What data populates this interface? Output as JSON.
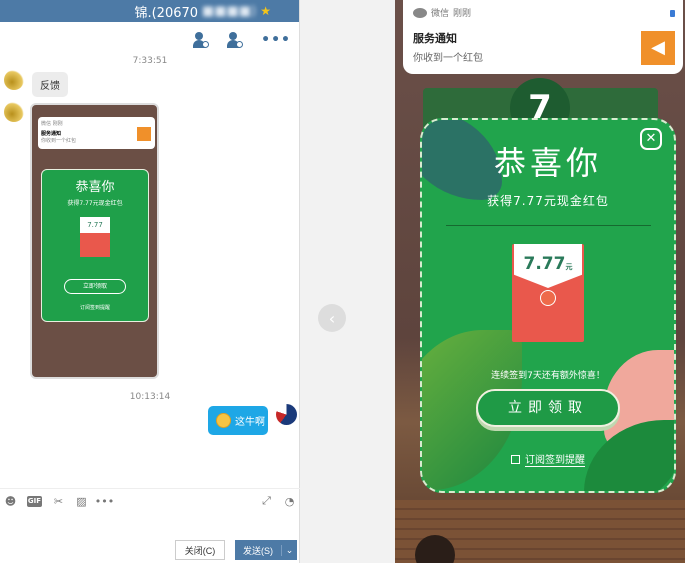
{
  "chat": {
    "title": "锦.(20670",
    "header_icons": [
      "add-contact-icon",
      "block-contact-icon",
      "more-icon"
    ],
    "more_label": "•••",
    "messages": [
      {
        "time": "7:33:51",
        "text": "反馈",
        "direction": "received"
      },
      {
        "type": "image",
        "direction": "received"
      },
      {
        "time": "10:13:14",
        "text": "这牛啊",
        "direction": "sent"
      }
    ],
    "thumbnail": {
      "notif_app": "微信 刚刚",
      "notif_title": "服务通知",
      "notif_body": "你收到一个红包",
      "card_title": "恭喜你",
      "card_sub": "获得7.77元现金红包",
      "amount": "7.77",
      "claim": "立即领取",
      "subscribe": "订阅签到提醒"
    },
    "toolbar": {
      "gif": "GIF",
      "more": "•••"
    },
    "close_button": "关闭(C)",
    "send_button": "发送(S)",
    "send_dropdown": "⌄"
  },
  "viewer": {
    "prev_arrow": "‹"
  },
  "screenshot": {
    "notification": {
      "app": "微信",
      "time": "刚刚",
      "title": "服务通知",
      "body": "你收到一个红包"
    },
    "bg_badge": "7",
    "card": {
      "close": "✕",
      "title": "恭喜你",
      "subtitle": "获得7.77元现金红包",
      "amount": "7.77",
      "unit": "元",
      "note": "连续签到7天还有额外惊喜！",
      "claim_button": "立即领取",
      "subscribe_label": "订阅签到提醒"
    },
    "colors": {
      "card_green": "#21a44c",
      "envelope_red": "#e9584c",
      "notif_orange": "#f0902a",
      "chat_header_blue": "#4d7aa6",
      "sent_bubble": "#1ea7e6"
    }
  }
}
